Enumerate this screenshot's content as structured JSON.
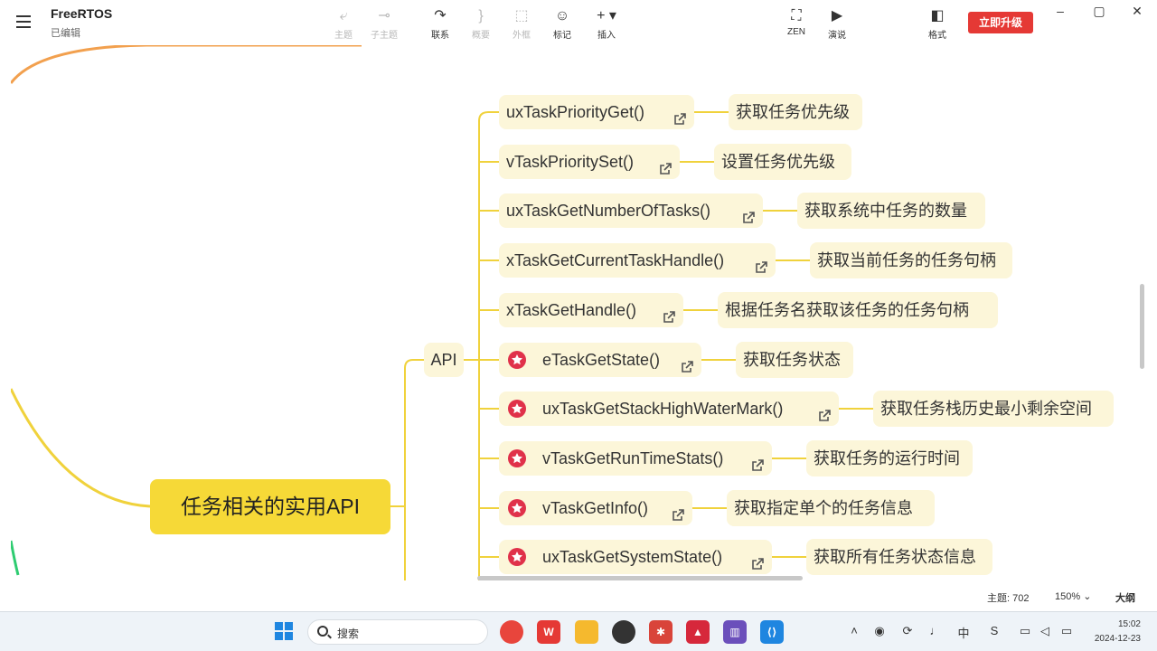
{
  "app": {
    "title": "FreeRTOS",
    "subtitle": "已编辑"
  },
  "toolbar": {
    "topic": "主题",
    "subtopic": "子主题",
    "relation": "联系",
    "summary": "概要",
    "boundary": "外框",
    "marker": "标记",
    "insert": "插入",
    "zen": "ZEN",
    "present": "演说",
    "format": "格式",
    "upgrade": "立即升级"
  },
  "mindmap": {
    "root": "任务相关的实用API",
    "branch": "API",
    "items": [
      {
        "fn": "uxTaskPriorityGet()",
        "desc": "获取任务优先级",
        "starred": false
      },
      {
        "fn": "vTaskPrioritySet()",
        "desc": "设置任务优先级",
        "starred": false
      },
      {
        "fn": "uxTaskGetNumberOfTasks()",
        "desc": "获取系统中任务的数量",
        "starred": false
      },
      {
        "fn": "xTaskGetCurrentTaskHandle()",
        "desc": "获取当前任务的任务句柄",
        "starred": false
      },
      {
        "fn": "xTaskGetHandle()",
        "desc": "根据任务名获取该任务的任务句柄",
        "starred": false
      },
      {
        "fn": "eTaskGetState()",
        "desc": "获取任务状态",
        "starred": true
      },
      {
        "fn": "uxTaskGetStackHighWaterMark()",
        "desc": "获取任务栈历史最小剩余空间",
        "starred": true
      },
      {
        "fn": "vTaskGetRunTimeStats()",
        "desc": "获取任务的运行时间",
        "starred": true
      },
      {
        "fn": "vTaskGetInfo()",
        "desc": "获取指定单个的任务信息",
        "starred": true
      },
      {
        "fn": "uxTaskGetSystemState()",
        "desc": "获取所有任务状态信息",
        "starred": true
      }
    ]
  },
  "status": {
    "topics": "主题: 702",
    "zoom": "150%",
    "outline": "大纲"
  },
  "taskbar": {
    "search_placeholder": "搜索",
    "time": "15:02",
    "date": "2024-12-23"
  },
  "colors": {
    "root": "#f6d937",
    "node": "#fcf6d9",
    "wire": "#f0d23c",
    "star": "#e0314a",
    "upgrade": "#e53935"
  }
}
